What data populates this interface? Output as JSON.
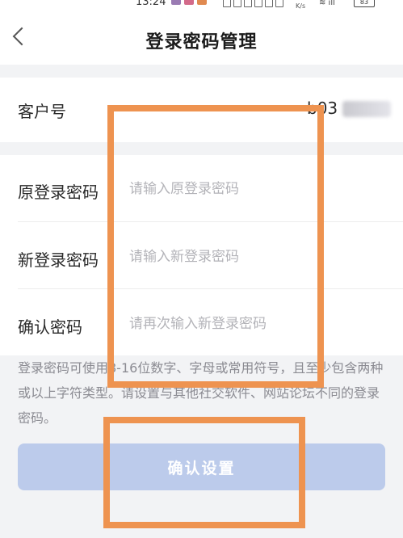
{
  "status_bar": {
    "time": "13:24",
    "network_speed": "K/s",
    "battery": "83"
  },
  "header": {
    "title": "登录密码管理",
    "back_icon": "chevron-left-icon"
  },
  "form": {
    "account_label": "客户号",
    "account_value": "b03",
    "old_password": {
      "label": "原登录密码",
      "placeholder": "请输入原登录密码",
      "value": ""
    },
    "new_password": {
      "label": "新登录密码",
      "placeholder": "请输入新登录密码",
      "value": ""
    },
    "confirm_password": {
      "label": "确认密码",
      "placeholder": "请再次输入新登录密码",
      "value": ""
    }
  },
  "hint": "登录密码可使用8-16位数字、字母或常用符号，且至少包含两种或以上字符类型。请设置与其他社交软件、网站论坛不同的登录密码。",
  "confirm_button_label": "确认设置",
  "colors": {
    "overlay": "#ee9350",
    "button": "#bccbeb"
  }
}
